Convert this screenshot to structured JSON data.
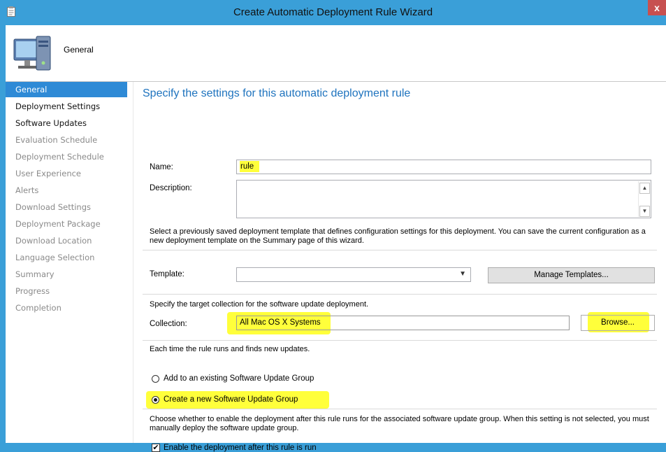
{
  "window": {
    "title": "Create Automatic Deployment Rule Wizard",
    "close_glyph": "x"
  },
  "header": {
    "title": "General"
  },
  "nav": {
    "items": [
      {
        "label": "General",
        "state": "active"
      },
      {
        "label": "Deployment Settings",
        "state": "done"
      },
      {
        "label": "Software Updates",
        "state": "done"
      },
      {
        "label": "Evaluation Schedule",
        "state": "pending"
      },
      {
        "label": "Deployment Schedule",
        "state": "pending"
      },
      {
        "label": "User Experience",
        "state": "pending"
      },
      {
        "label": "Alerts",
        "state": "pending"
      },
      {
        "label": "Download Settings",
        "state": "pending"
      },
      {
        "label": "Deployment Package",
        "state": "pending"
      },
      {
        "label": "Download Location",
        "state": "pending"
      },
      {
        "label": "Language Selection",
        "state": "pending"
      },
      {
        "label": "Summary",
        "state": "pending"
      },
      {
        "label": "Progress",
        "state": "pending"
      },
      {
        "label": "Completion",
        "state": "pending"
      }
    ]
  },
  "main": {
    "heading": "Specify the settings for this automatic deployment rule",
    "name_label": "Name:",
    "name_value": "rule",
    "description_label": "Description:",
    "description_value": "",
    "template_info": "Select a previously saved deployment template that defines configuration settings for this deployment. You can save the current configuration as a new deployment template on the Summary page of this wizard.",
    "template_label": "Template:",
    "template_value": "",
    "manage_templates_button": "Manage Templates...",
    "collection_info": "Specify the target collection for the software update deployment.",
    "collection_label": "Collection:",
    "collection_value": "All Mac OS X Systems",
    "browse_button": "Browse...",
    "runs_info": "Each time the rule runs and finds new updates.",
    "radio_existing": "Add to an existing Software Update Group",
    "radio_new": "Create a new Software Update Group",
    "radio_selected": "new",
    "enable_info": "Choose whether to enable the deployment after this rule runs for the associated software update group. When this setting is not selected, you must manually deploy the software update group.",
    "enable_checkbox_label": "Enable the deployment after this rule is run",
    "enable_checked": true
  },
  "colors": {
    "accent": "#2e8ad6",
    "title_bar": "#3a9fd8",
    "heading": "#1e73be",
    "highlight": "#ffff3b"
  }
}
